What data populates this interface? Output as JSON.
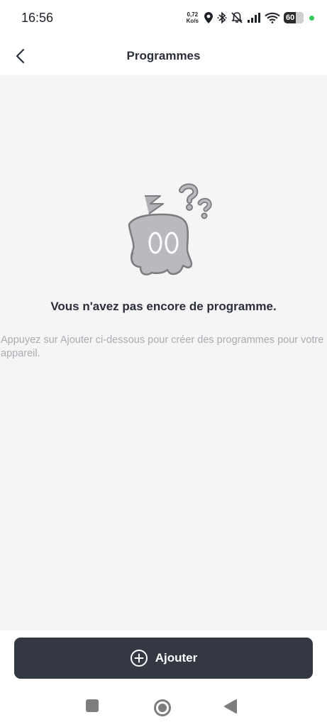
{
  "status_bar": {
    "time": "16:56",
    "net_speed_value": "0,72",
    "net_speed_unit": "Ko/s",
    "battery_level": "60",
    "icons": [
      "location-icon",
      "bluetooth-icon",
      "mute-icon",
      "signal-icon",
      "wifi-icon",
      "battery-icon"
    ]
  },
  "header": {
    "title": "Programmes"
  },
  "empty_state": {
    "title": "Vous n'avez pas encore de programme.",
    "description": "Appuyez sur Ajouter ci-dessous pour créer des programmes pour votre appareil."
  },
  "footer": {
    "add_label": "Ajouter"
  },
  "colors": {
    "button_bg": "#333843",
    "content_bg": "#f5f5f5",
    "description_text": "#a9acb2",
    "status_dot": "#34c759"
  }
}
